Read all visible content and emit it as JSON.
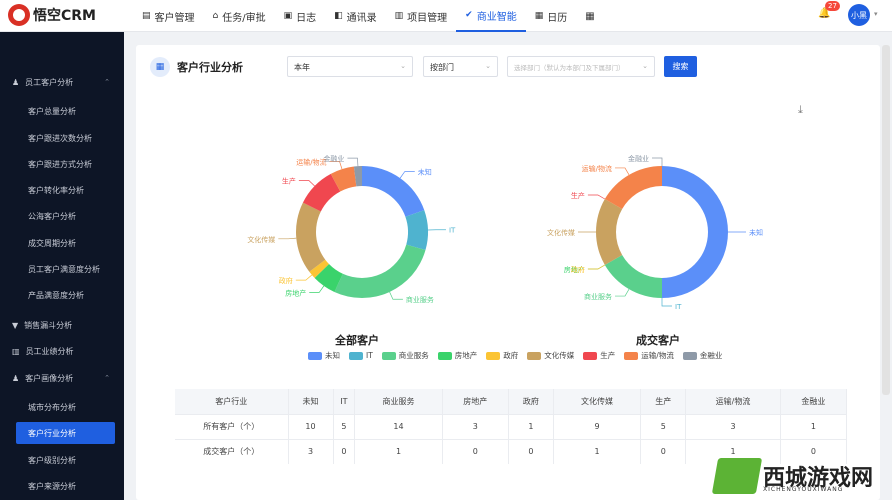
{
  "app": {
    "logo": "悟空CRM"
  },
  "nav": [
    {
      "label": "客户管理",
      "icon": "customer-icon"
    },
    {
      "label": "任务/审批",
      "icon": "task-icon"
    },
    {
      "label": "日志",
      "icon": "log-icon"
    },
    {
      "label": "通讯录",
      "icon": "contacts-icon"
    },
    {
      "label": "项目管理",
      "icon": "project-icon"
    },
    {
      "label": "商业智能",
      "icon": "bi-icon",
      "active": true
    },
    {
      "label": "日历",
      "icon": "calendar-icon"
    }
  ],
  "header": {
    "notification_count": "27",
    "user": "小黑"
  },
  "sidebar": {
    "groups": [
      {
        "label": "员工客户分析",
        "items": [
          "客户总量分析",
          "客户跟进次数分析",
          "客户跟进方式分析",
          "客户转化率分析",
          "公海客户分析",
          "成交周期分析",
          "员工客户满意度分析",
          "产品满意度分析"
        ]
      },
      {
        "label": "销售漏斗分析",
        "items": []
      },
      {
        "label": "员工业绩分析",
        "items": []
      },
      {
        "label": "客户画像分析",
        "items": [
          "城市分布分析",
          "客户行业分析",
          "客户级别分析",
          "客户来源分析"
        ]
      }
    ],
    "active": "客户行业分析"
  },
  "page": {
    "title": "客户行业分析",
    "period": "本年",
    "scope": "按部门",
    "dept_placeholder": "选择部门（默认为本部门及下属部门）",
    "search": "搜索"
  },
  "chart_data": [
    {
      "type": "pie",
      "title": "全部客户",
      "categories": [
        "未知",
        "IT",
        "商业服务",
        "房地产",
        "政府",
        "文化传媒",
        "生产",
        "运输/物流",
        "金融业"
      ],
      "values": [
        10,
        5,
        14,
        3,
        1,
        9,
        5,
        3,
        1
      ]
    },
    {
      "type": "pie",
      "title": "成交客户",
      "categories": [
        "未知",
        "IT",
        "商业服务",
        "房地产",
        "政府",
        "文化传媒",
        "生产",
        "运输/物流",
        "金融业"
      ],
      "values": [
        3,
        0,
        1,
        0,
        0,
        1,
        0,
        1,
        0
      ]
    }
  ],
  "legend": {
    "colors": [
      "#5b8ff9",
      "#4fb3cf",
      "#5ad08c",
      "#3ad36b",
      "#fbc434",
      "#c9a260",
      "#f0474f",
      "#f4834a",
      "#8e9aa8"
    ]
  },
  "table": {
    "headers": [
      "客户行业",
      "未知",
      "IT",
      "商业服务",
      "房地产",
      "政府",
      "文化传媒",
      "生产",
      "运输/物流",
      "金融业"
    ],
    "rows": [
      [
        "所有客户（个）",
        "10",
        "5",
        "14",
        "3",
        "1",
        "9",
        "5",
        "3",
        "1"
      ],
      [
        "成交客户（个）",
        "3",
        "0",
        "1",
        "0",
        "0",
        "1",
        "0",
        "1",
        "0"
      ]
    ]
  },
  "watermark": {
    "text": "西城游戏网",
    "sub": "XICHENGYOUXIWANG"
  }
}
